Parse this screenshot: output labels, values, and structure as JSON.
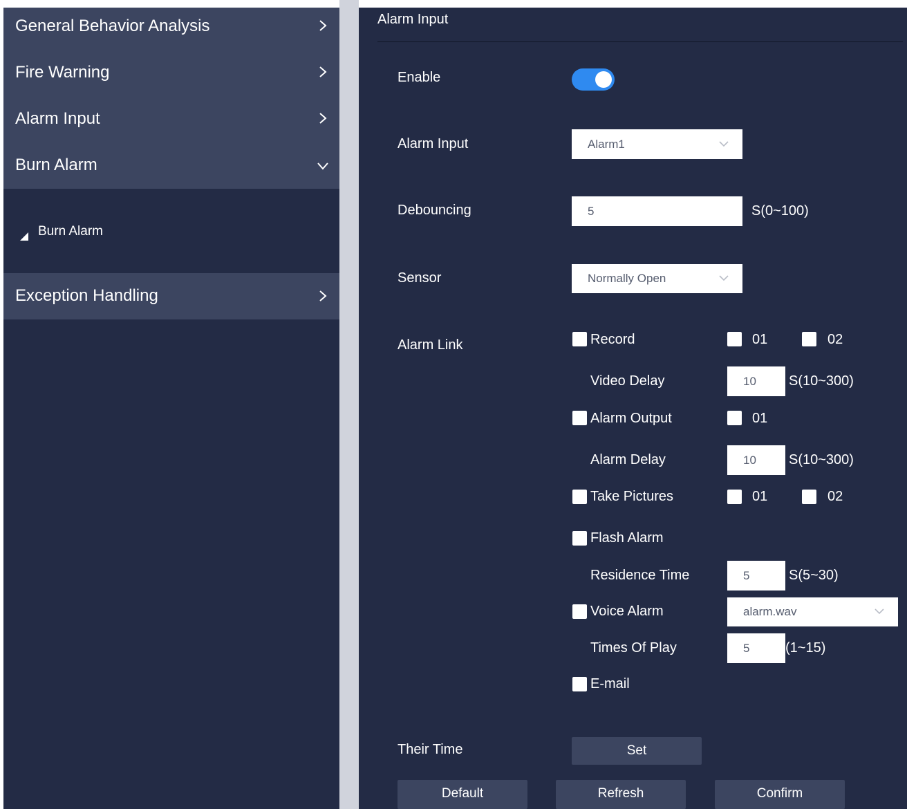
{
  "sidebar": {
    "items": [
      {
        "label": "General Behavior Analysis",
        "icon": "chevron-right-icon"
      },
      {
        "label": "Fire Warning",
        "icon": "chevron-right-icon"
      },
      {
        "label": "Alarm Input",
        "icon": "chevron-right-icon"
      },
      {
        "label": "Burn Alarm",
        "icon": "chevron-down-icon"
      },
      {
        "label": "Exception Handling",
        "icon": "chevron-right-icon"
      }
    ],
    "sub_item": {
      "label": "Burn Alarm",
      "icon": "triangle-expanded-icon"
    }
  },
  "main": {
    "title": "Alarm Input",
    "form": {
      "enable": {
        "label": "Enable",
        "checked": true
      },
      "alarm_input": {
        "label": "Alarm Input",
        "value": "Alarm1"
      },
      "debouncing": {
        "label": "Debouncing",
        "value": "5",
        "range": "S(0~100)"
      },
      "sensor": {
        "label": "Sensor",
        "value": "Normally Open"
      },
      "alarm_link": {
        "label": "Alarm Link",
        "record": {
          "label": "Record",
          "ch1": "01",
          "ch2": "02"
        },
        "video_delay": {
          "label": "Video Delay",
          "value": "10",
          "range": "S(10~300)"
        },
        "alarm_output": {
          "label": "Alarm Output",
          "ch1": "01"
        },
        "alarm_delay": {
          "label": "Alarm Delay",
          "value": "10",
          "range": "S(10~300)"
        },
        "take_pictures": {
          "label": "Take Pictures",
          "ch1": "01",
          "ch2": "02"
        },
        "flash_alarm": {
          "label": "Flash Alarm"
        },
        "residence_time": {
          "label": "Residence Time",
          "value": "5",
          "range": "S(5~30)"
        },
        "voice_alarm": {
          "label": "Voice Alarm",
          "file": "alarm.wav"
        },
        "times_of_play": {
          "label": "Times Of Play",
          "value": "5",
          "range": "(1~15)"
        },
        "email": {
          "label": "E-mail"
        }
      },
      "their_time": {
        "label": "Their Time",
        "button": "Set"
      }
    },
    "buttons": {
      "default": "Default",
      "refresh": "Refresh",
      "confirm": "Confirm"
    }
  },
  "colors": {
    "panel": "#232b45",
    "nav_item": "#3c4560",
    "accent": "#2f8af0",
    "divider": "#d0d3dc"
  }
}
